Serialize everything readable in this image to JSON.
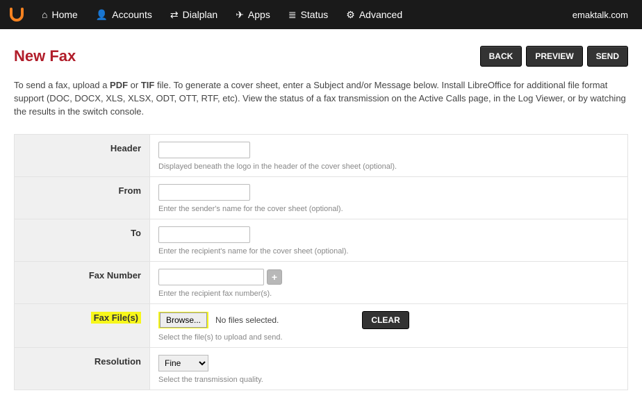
{
  "nav": {
    "brand_text": "emaktalk.com",
    "items": [
      {
        "label": "Home"
      },
      {
        "label": "Accounts"
      },
      {
        "label": "Dialplan"
      },
      {
        "label": "Apps"
      },
      {
        "label": "Status"
      },
      {
        "label": "Advanced"
      }
    ]
  },
  "page": {
    "title": "New Fax",
    "buttons": {
      "back": "BACK",
      "preview": "PREVIEW",
      "send": "SEND"
    },
    "intro_pre": "To send a fax, upload a ",
    "intro_pdf": "PDF",
    "intro_or": " or ",
    "intro_tif": "TIF",
    "intro_post": " file. To generate a cover sheet, enter a Subject and/or Message below. Install LibreOffice for additional file format support (DOC, DOCX, XLS, XLSX, ODT, OTT, RTF, etc). View the status of a fax transmission on the Active Calls page, in the Log Viewer, or by watching the results in the switch console."
  },
  "form": {
    "header": {
      "label": "Header",
      "value": "",
      "hint": "Displayed beneath the logo in the header of the cover sheet (optional)."
    },
    "from": {
      "label": "From",
      "value": "",
      "hint": "Enter the sender's name for the cover sheet (optional)."
    },
    "to": {
      "label": "To",
      "value": "",
      "hint": "Enter the recipient's name for the cover sheet (optional)."
    },
    "fax_number": {
      "label": "Fax Number",
      "value": "",
      "hint": "Enter the recipient fax number(s)."
    },
    "fax_files": {
      "label": "Fax File(s)",
      "browse": "Browse...",
      "status": "No files selected.",
      "clear": "CLEAR",
      "hint": "Select the file(s) to upload and send."
    },
    "resolution": {
      "label": "Resolution",
      "selected": "Fine",
      "hint": "Select the transmission quality."
    }
  }
}
